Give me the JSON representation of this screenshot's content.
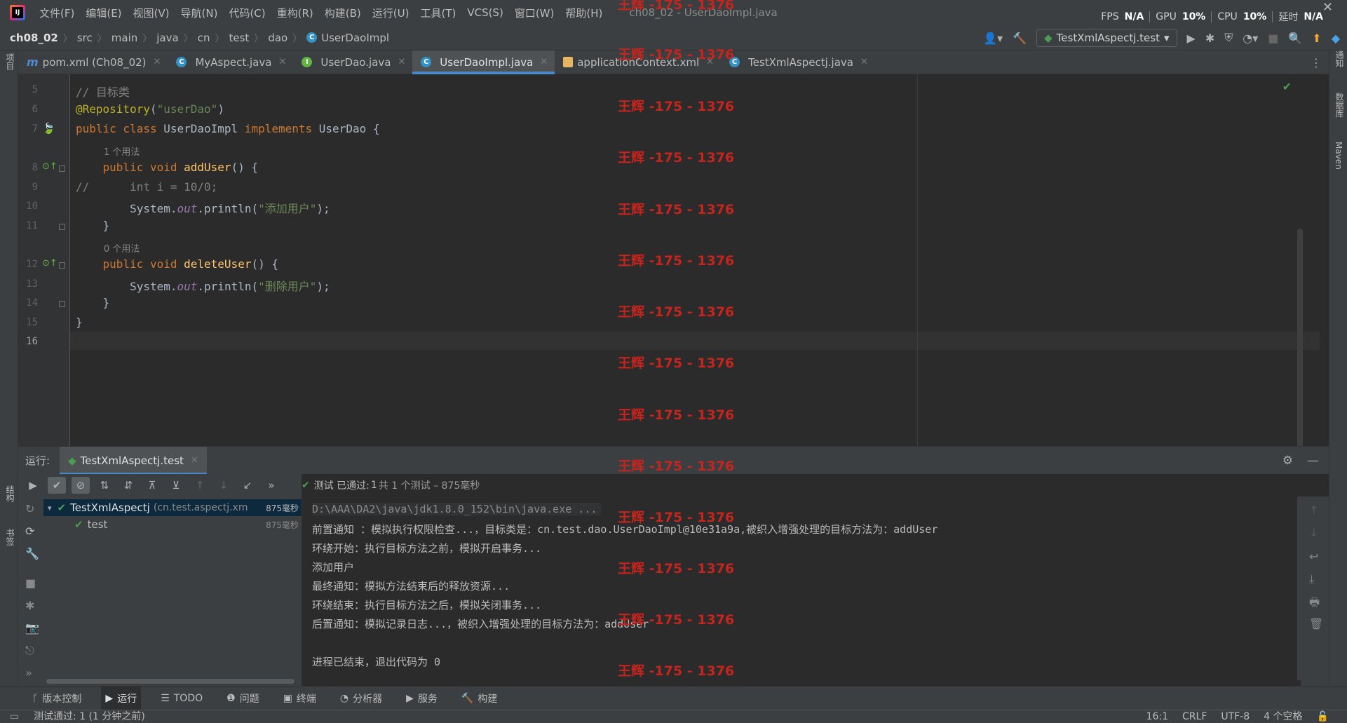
{
  "menu": [
    "文件(F)",
    "编辑(E)",
    "视图(V)",
    "导航(N)",
    "代码(C)",
    "重构(R)",
    "构建(B)",
    "运行(U)",
    "工具(T)",
    "VCS(S)",
    "窗口(W)",
    "帮助(H)"
  ],
  "window_title": "ch08_02 - UserDaoImpl.java",
  "perf": {
    "fps_label": "FPS",
    "fps_val": "N/A",
    "gpu_label": "GPU",
    "gpu_val": "10%",
    "cpu_label": "CPU",
    "cpu_val": "10%",
    "latency_label": "延时",
    "latency_val": "N/A"
  },
  "breadcrumb": [
    "ch08_02",
    "src",
    "main",
    "java",
    "cn",
    "test",
    "dao",
    "UserDaoImpl"
  ],
  "run_config": "TestXmlAspectj.test",
  "tabs": [
    {
      "label": "pom.xml (Ch08_02)",
      "icon": "maven-icon"
    },
    {
      "label": "MyAspect.java",
      "icon": "class-icon"
    },
    {
      "label": "UserDao.java",
      "icon": "interface-icon"
    },
    {
      "label": "UserDaoImpl.java",
      "icon": "class-icon",
      "active": true
    },
    {
      "label": "applicationContext.xml",
      "icon": "xml-icon"
    },
    {
      "label": "TestXmlAspectj.java",
      "icon": "class-icon"
    }
  ],
  "left_stripe": {
    "project": "项目",
    "structure": "结构",
    "bookmarks": "书签"
  },
  "right_stripe": {
    "notifications": "通知",
    "database": "数据库",
    "maven": "Maven"
  },
  "code": {
    "line_numbers": [
      "5",
      "6",
      "7",
      "8",
      "9",
      "10",
      "11",
      "12",
      "13",
      "14",
      "15",
      "16"
    ],
    "hint_usage_1": "1 个用法",
    "hint_usage_0": "0 个用法",
    "l5": "// 目标类",
    "l6_ann": "@Repository",
    "l6_open": "(",
    "l6_str": "\"userDao\"",
    "l6_close": ")",
    "l7_kw1": "public class",
    "l7_name": " UserDaoImpl ",
    "l7_kw2": "implements",
    "l7_rest": " UserDao {",
    "l8_kw": "    public void",
    "l8_fn": " addUser",
    "l8_rest": "() {",
    "l9": "//      int i = 10/0;",
    "l10_pre": "        System.",
    "l10_out": "out",
    "l10_mid": ".println(",
    "l10_str": "\"添加用户\"",
    "l10_end": ");",
    "l11": "    }",
    "l12_kw": "    public void",
    "l12_fn": " deleteUser",
    "l12_rest": "() {",
    "l13_pre": "        System.",
    "l13_out": "out",
    "l13_mid": ".println(",
    "l13_str": "\"删除用户\"",
    "l13_end": ");",
    "l14": "    }",
    "l15": "}"
  },
  "watermark": "王辉 -175 - 1376",
  "run_panel": {
    "label": "运行:",
    "tab": "TestXmlAspectj.test",
    "status_prefix": "测试 已通过:",
    "status_count": "1",
    "status_suffix": "共 1 个测试 – 875毫秒"
  },
  "tree": {
    "root_name": "TestXmlAspectj",
    "root_pkg": "(cn.test.aspectj.xm",
    "root_time": "875毫秒",
    "child_name": "test",
    "child_time": "875毫秒"
  },
  "console": [
    "D:\\AAA\\DA2\\java\\jdk1.8.0_152\\bin\\java.exe ...",
    "前置通知 ：模拟执行权限检查...，目标类是：cn.test.dao.UserDaoImpl@10e31a9a,被织入增强处理的目标方法为：addUser",
    "环绕开始：执行目标方法之前，模拟开启事务...",
    "添加用户",
    "最终通知：模拟方法结束后的释放资源...",
    "环绕结束：执行目标方法之后，模拟关闭事务...",
    "后置通知：模拟记录日志...，被织入增强处理的目标方法为：addUser",
    "",
    "进程已结束，退出代码为 0"
  ],
  "bottom_tools": [
    "版本控制",
    "运行",
    "TODO",
    "问题",
    "终端",
    "分析器",
    "服务",
    "构建"
  ],
  "status": {
    "message": "测试通过: 1 (1 分钟之前)",
    "position": "16:1",
    "line_sep": "CRLF",
    "encoding": "UTF-8",
    "indent": "4 个空格"
  }
}
